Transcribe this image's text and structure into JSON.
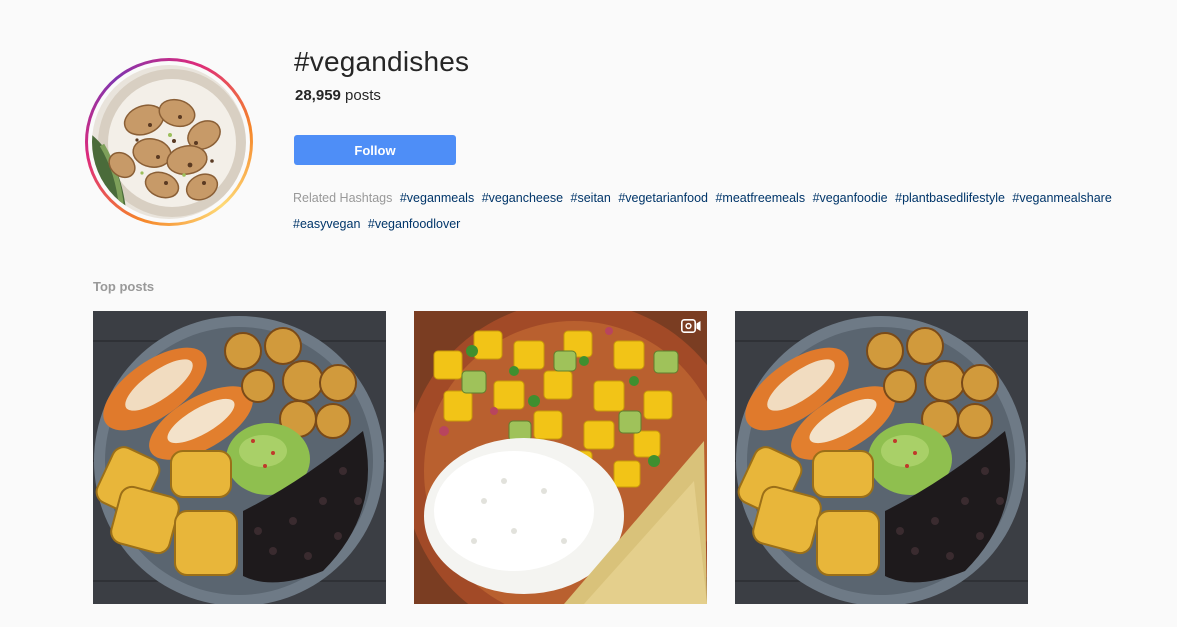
{
  "header": {
    "hashtag_title": "#vegandishes",
    "post_count": "28,959",
    "post_count_suffix": " posts",
    "follow_label": "Follow"
  },
  "related": {
    "label": "Related Hashtags",
    "hashtags": [
      "#veganmeals",
      "#vegancheese",
      "#seitan",
      "#vegetarianfood",
      "#meatfreemeals",
      "#veganfoodie",
      "#plantbasedlifestyle",
      "#veganmealshare",
      "#easyvegan",
      "#veganfoodlover"
    ]
  },
  "top_posts": {
    "title": "Top posts",
    "posts": [
      {
        "icon": "none"
      },
      {
        "icon": "video-icon"
      },
      {
        "icon": "none"
      }
    ]
  },
  "colors": {
    "follow_button": "#4e8ef7",
    "hashtag_link": "#003569",
    "muted_text": "#999999",
    "background": "#fafafa"
  }
}
